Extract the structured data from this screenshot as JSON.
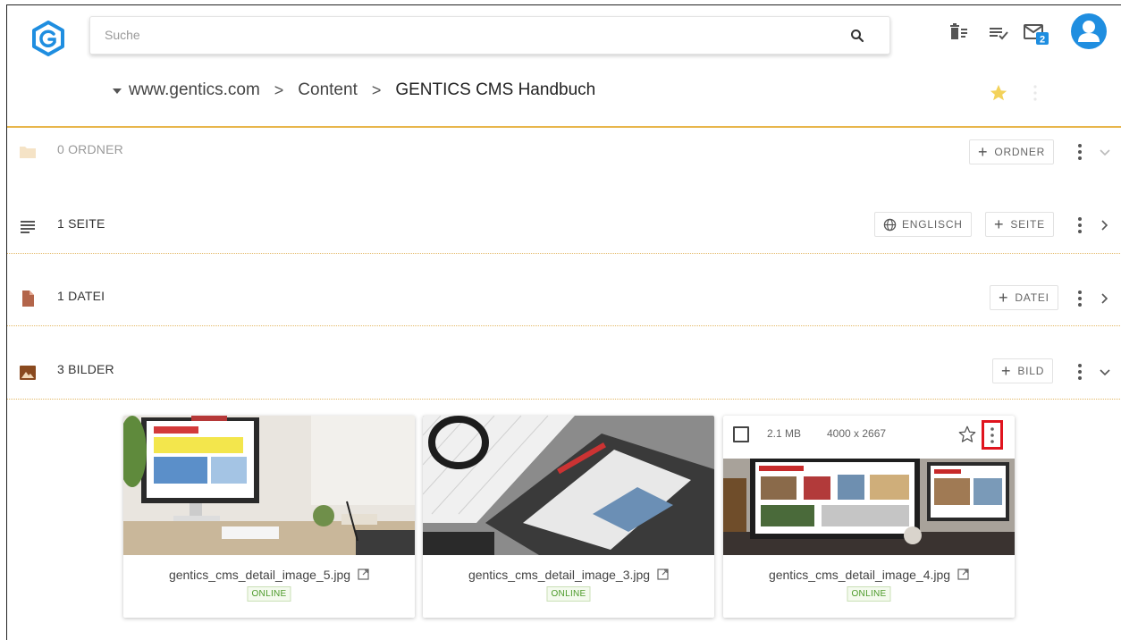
{
  "topbar": {
    "search_placeholder": "Suche",
    "messages_count": "2",
    "icons": [
      "wastebin-icon",
      "task-list-icon",
      "message-inbox-icon",
      "user-avatar-icon"
    ]
  },
  "breadcrumb": {
    "items": [
      "www.gentics.com",
      "Content",
      "GENTICS CMS Handbuch"
    ],
    "separator": ">"
  },
  "sections": {
    "folders": {
      "label": "0 ORDNER",
      "button": "ORDNER",
      "icon": "folder-icon"
    },
    "pages": {
      "label": "1 SEITE",
      "language_button": "ENGLISCH",
      "button": "SEITE",
      "icon": "page-icon"
    },
    "files": {
      "label": "1 DATEI",
      "button": "DATEI",
      "icon": "file-icon"
    },
    "images": {
      "label": "3 BILDER",
      "button": "BILD",
      "icon": "image-icon"
    }
  },
  "images": [
    {
      "name": "gentics_cms_detail_image_5.jpg",
      "status": "ONLINE"
    },
    {
      "name": "gentics_cms_detail_image_3.jpg",
      "status": "ONLINE"
    },
    {
      "name": "gentics_cms_detail_image_4.jpg",
      "status": "ONLINE",
      "size": "2.1 MB",
      "dimensions": "4000 x 2667"
    }
  ],
  "colors": {
    "accent_gold": "#e8b64b",
    "brand_blue": "#1f8ee0",
    "online_green": "#4c9a2a",
    "highlight_red": "#e0141e"
  }
}
